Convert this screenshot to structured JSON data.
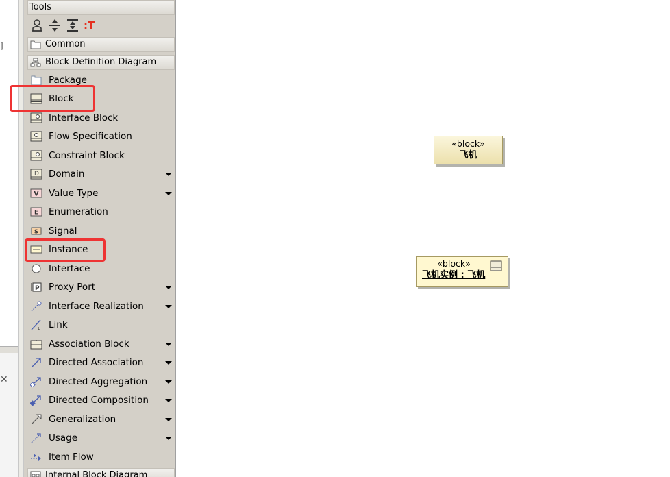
{
  "left_stub": {
    "text": "]",
    "close_glyph": "✕"
  },
  "palette": {
    "tools_header": "Tools",
    "tool_icons": [
      "select-icon",
      "sweep-icon",
      "insert-space-icon",
      "text-tool-icon"
    ],
    "groups": [
      {
        "label": "Common",
        "icon": "folder-icon"
      },
      {
        "label": "Block Definition Diagram",
        "icon": "bdd-icon"
      },
      {
        "label": "Internal Block Diagram",
        "icon": "ibd-icon"
      }
    ],
    "items": [
      {
        "label": "Package",
        "icon": "package-icon",
        "dropdown": false
      },
      {
        "label": "Block",
        "icon": "block-icon",
        "dropdown": false
      },
      {
        "label": "Interface Block",
        "icon": "interface-block-icon",
        "dropdown": false
      },
      {
        "label": "Flow Specification",
        "icon": "flow-specification-icon",
        "dropdown": false
      },
      {
        "label": "Constraint Block",
        "icon": "constraint-block-icon",
        "dropdown": false
      },
      {
        "label": "Domain",
        "icon": "domain-icon",
        "dropdown": true
      },
      {
        "label": "Value Type",
        "icon": "value-type-icon",
        "dropdown": true
      },
      {
        "label": "Enumeration",
        "icon": "enumeration-icon",
        "dropdown": false
      },
      {
        "label": "Signal",
        "icon": "signal-icon",
        "dropdown": false
      },
      {
        "label": "Instance",
        "icon": "instance-icon",
        "dropdown": false
      },
      {
        "label": "Interface",
        "icon": "interface-icon",
        "dropdown": false
      },
      {
        "label": "Proxy Port",
        "icon": "proxy-port-icon",
        "dropdown": true
      },
      {
        "label": "Interface Realization",
        "icon": "interface-realization-icon",
        "dropdown": true
      },
      {
        "label": "Link",
        "icon": "link-icon",
        "dropdown": false
      },
      {
        "label": "Association Block",
        "icon": "association-block-icon",
        "dropdown": true
      },
      {
        "label": "Directed Association",
        "icon": "directed-association-icon",
        "dropdown": true
      },
      {
        "label": "Directed Aggregation",
        "icon": "directed-aggregation-icon",
        "dropdown": true
      },
      {
        "label": "Directed Composition",
        "icon": "directed-composition-icon",
        "dropdown": true
      },
      {
        "label": "Generalization",
        "icon": "generalization-icon",
        "dropdown": true
      },
      {
        "label": "Usage",
        "icon": "usage-icon",
        "dropdown": true
      },
      {
        "label": "Item Flow",
        "icon": "item-flow-icon",
        "dropdown": false
      }
    ],
    "icon_letters": {
      "value_type": "V",
      "enumeration": "E",
      "signal": "S",
      "proxy_port": "P",
      "text_tool": ":T"
    }
  },
  "canvas": {
    "block": {
      "stereotype": "«block»",
      "name": "飞机"
    },
    "instance": {
      "stereotype": "«block»",
      "name": "飞机实例 : 飞机"
    }
  },
  "colors": {
    "highlight": "#ee3333",
    "block_fill": "#f3ebc4",
    "instance_fill": "#fff8d0",
    "palette_bg": "#d4d0c8"
  }
}
